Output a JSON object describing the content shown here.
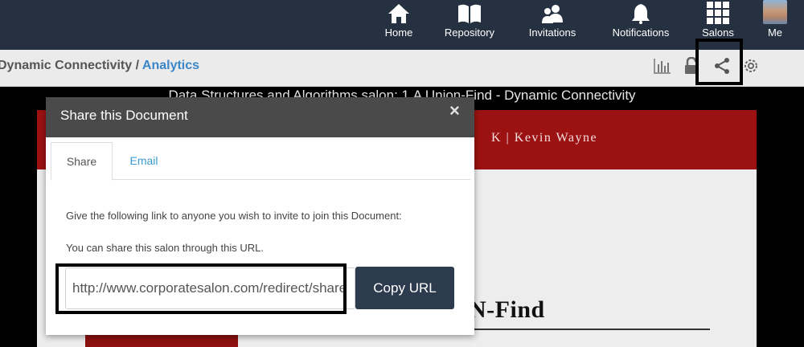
{
  "nav": {
    "items": [
      {
        "label": "Home",
        "icon": "home-icon"
      },
      {
        "label": "Repository",
        "icon": "book-icon"
      },
      {
        "label": "Invitations",
        "icon": "users-icon"
      },
      {
        "label": "Notifications",
        "icon": "bell-icon"
      },
      {
        "label": "Salons",
        "icon": "grid-icon"
      },
      {
        "label": "Me",
        "icon": "avatar"
      }
    ]
  },
  "breadcrumb": {
    "current": "Dynamic Connectivity",
    "separator": " / ",
    "link": "Analytics"
  },
  "toolbar": {
    "icons": [
      "analytics-icon",
      "lock-icon",
      "share-icon",
      "gear-icon"
    ]
  },
  "document": {
    "title": "Data Structures and Algorithms salon: 1.A Union-Find - Dynamic Connectivity",
    "slide_author": "K  |  Kevin Wayne",
    "slide_heading": "N-Find"
  },
  "modal": {
    "title": "Share this Document",
    "close": "×",
    "tabs": [
      {
        "label": "Share",
        "active": true
      },
      {
        "label": "Email",
        "active": false
      }
    ],
    "instruction": "Give the following link to anyone you wish to invite to join this Document:",
    "subtext": "You can share this salon through this URL.",
    "url": "http://www.corporatesalon.com/redirect/share",
    "copy_button": "Copy URL"
  },
  "colors": {
    "nav_bg": "#253041",
    "accent_link": "#3a86c8",
    "slide_band": "#9c1212",
    "copy_button": "#2d3b4e"
  }
}
